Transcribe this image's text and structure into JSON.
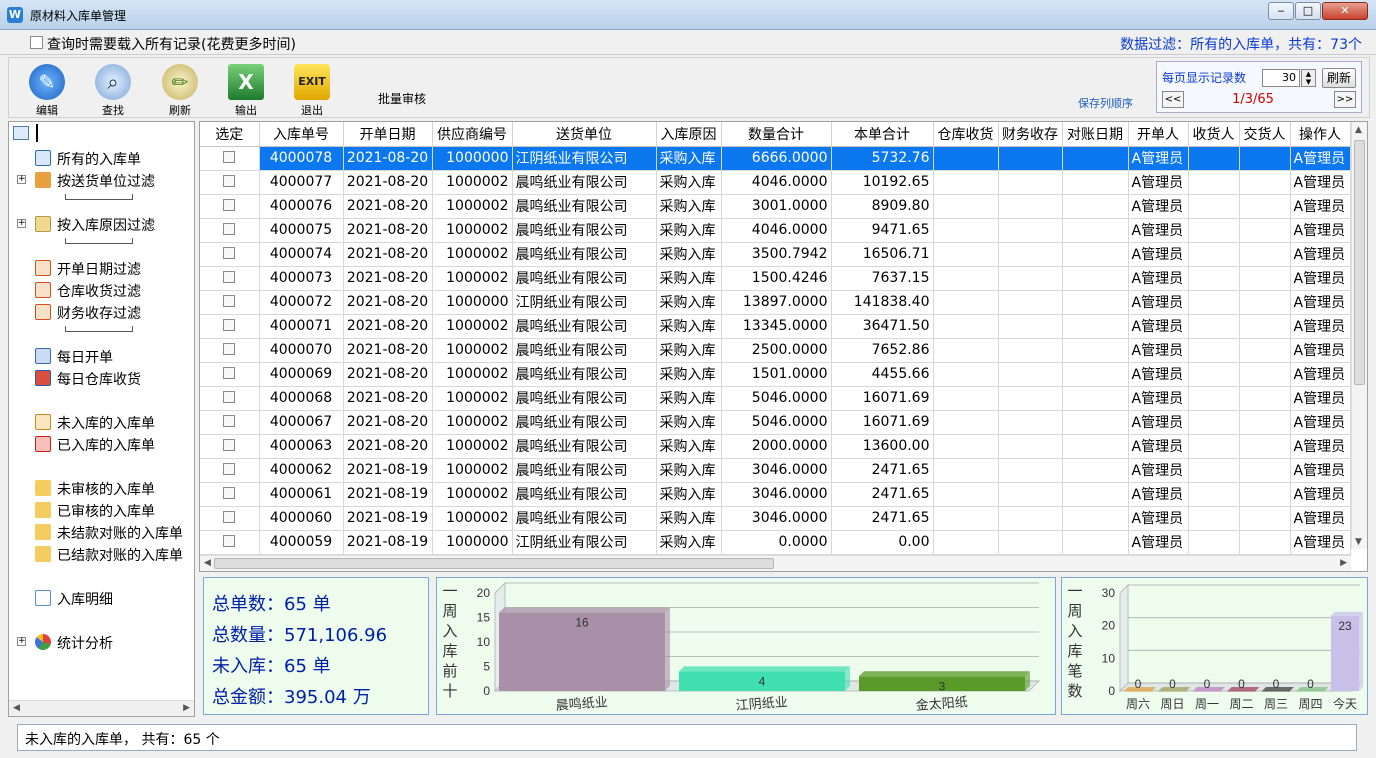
{
  "window": {
    "title": "原材料入库单管理",
    "app_icon": "W"
  },
  "filter_bar": {
    "load_all_label": "查询时需要载入所有记录(花费更多时间)",
    "data_filter_text": "数据过滤：所有的入库单，共有：73个"
  },
  "toolbar": {
    "buttons": [
      {
        "label": "编辑",
        "icon": "edit-pen-icon"
      },
      {
        "label": "查找",
        "icon": "search-magnifier-icon"
      },
      {
        "label": "刷新",
        "icon": "refresh-pencil-icon"
      },
      {
        "label": "输出",
        "icon": "excel-icon"
      },
      {
        "label": "退出",
        "icon": "exit-icon"
      }
    ],
    "batch_audit": "批量审核",
    "save_column_order": "保存列顺序"
  },
  "pager": {
    "per_page_label": "每页显示记录数",
    "per_page_value": "30",
    "refresh_label": "刷新",
    "prev": "<<",
    "page_text": "1/3/65",
    "next": ">>"
  },
  "tree": {
    "items": [
      {
        "label": "所有的入库单",
        "icon": "list-icon"
      },
      {
        "label": "按送货单位过滤",
        "icon": "home-icon"
      },
      {
        "label": "按入库原因过滤",
        "icon": "document-icon"
      },
      {
        "label": "开单日期过滤",
        "icon": "calendar-icon"
      },
      {
        "label": "仓库收货过滤",
        "icon": "calendar-icon"
      },
      {
        "label": "财务收存过滤",
        "icon": "calendar-icon"
      },
      {
        "label": "每日开单",
        "icon": "edit-doc-icon"
      },
      {
        "label": "每日仓库收货",
        "icon": "grid-doc-icon"
      },
      {
        "label": "未入库的入库单",
        "icon": "calendar-add-icon"
      },
      {
        "label": "已入库的入库单",
        "icon": "calendar-check-icon"
      },
      {
        "label": "未审核的入库单",
        "icon": "folder-edit-icon"
      },
      {
        "label": "已审核的入库单",
        "icon": "folder-check-icon"
      },
      {
        "label": "未结款对账的入库单",
        "icon": "folder-edit-icon"
      },
      {
        "label": "已结款对账的入库单",
        "icon": "folder-check-icon"
      },
      {
        "label": "入库明细",
        "icon": "document-edit-icon"
      },
      {
        "label": "统计分析",
        "icon": "pie-chart-icon"
      }
    ]
  },
  "grid": {
    "columns": [
      "选定",
      "入库单号",
      "开单日期",
      "供应商编号",
      "送货单位",
      "入库原因",
      "数量合计",
      "本单合计",
      "仓库收货",
      "财务收存",
      "对账日期",
      "开单人",
      "收货人",
      "交货人",
      "操作人"
    ],
    "rows": [
      [
        "4000078",
        "2021-08-20",
        "1000000",
        "江阴纸业有限公司",
        "采购入库",
        "6666.0000",
        "5732.76",
        "A管理员",
        "A管理员"
      ],
      [
        "4000077",
        "2021-08-20",
        "1000002",
        "晨鸣纸业有限公司",
        "采购入库",
        "4046.0000",
        "10192.65",
        "A管理员",
        "A管理员"
      ],
      [
        "4000076",
        "2021-08-20",
        "1000002",
        "晨鸣纸业有限公司",
        "采购入库",
        "3001.0000",
        "8909.80",
        "A管理员",
        "A管理员"
      ],
      [
        "4000075",
        "2021-08-20",
        "1000002",
        "晨鸣纸业有限公司",
        "采购入库",
        "4046.0000",
        "9471.65",
        "A管理员",
        "A管理员"
      ],
      [
        "4000074",
        "2021-08-20",
        "1000002",
        "晨鸣纸业有限公司",
        "采购入库",
        "3500.7942",
        "16506.71",
        "A管理员",
        "A管理员"
      ],
      [
        "4000073",
        "2021-08-20",
        "1000002",
        "晨鸣纸业有限公司",
        "采购入库",
        "1500.4246",
        "7637.15",
        "A管理员",
        "A管理员"
      ],
      [
        "4000072",
        "2021-08-20",
        "1000000",
        "江阴纸业有限公司",
        "采购入库",
        "13897.0000",
        "141838.40",
        "A管理员",
        "A管理员"
      ],
      [
        "4000071",
        "2021-08-20",
        "1000002",
        "晨鸣纸业有限公司",
        "采购入库",
        "13345.0000",
        "36471.50",
        "A管理员",
        "A管理员"
      ],
      [
        "4000070",
        "2021-08-20",
        "1000002",
        "晨鸣纸业有限公司",
        "采购入库",
        "2500.0000",
        "7652.86",
        "A管理员",
        "A管理员"
      ],
      [
        "4000069",
        "2021-08-20",
        "1000002",
        "晨鸣纸业有限公司",
        "采购入库",
        "1501.0000",
        "4455.66",
        "A管理员",
        "A管理员"
      ],
      [
        "4000068",
        "2021-08-20",
        "1000002",
        "晨鸣纸业有限公司",
        "采购入库",
        "5046.0000",
        "16071.69",
        "A管理员",
        "A管理员"
      ],
      [
        "4000067",
        "2021-08-20",
        "1000002",
        "晨鸣纸业有限公司",
        "采购入库",
        "5046.0000",
        "16071.69",
        "A管理员",
        "A管理员"
      ],
      [
        "4000063",
        "2021-08-20",
        "1000002",
        "晨鸣纸业有限公司",
        "采购入库",
        "2000.0000",
        "13600.00",
        "A管理员",
        "A管理员"
      ],
      [
        "4000062",
        "2021-08-19",
        "1000002",
        "晨鸣纸业有限公司",
        "采购入库",
        "3046.0000",
        "2471.65",
        "A管理员",
        "A管理员"
      ],
      [
        "4000061",
        "2021-08-19",
        "1000002",
        "晨鸣纸业有限公司",
        "采购入库",
        "3046.0000",
        "2471.65",
        "A管理员",
        "A管理员"
      ],
      [
        "4000060",
        "2021-08-19",
        "1000002",
        "晨鸣纸业有限公司",
        "采购入库",
        "3046.0000",
        "2471.65",
        "A管理员",
        "A管理员"
      ],
      [
        "4000059",
        "2021-08-19",
        "1000000",
        "江阴纸业有限公司",
        "采购入库",
        "0.0000",
        "0.00",
        "A管理员",
        "A管理员"
      ]
    ]
  },
  "summary": {
    "total_orders": "总单数：65 单",
    "total_qty": "总数量：571,106.96",
    "not_stocked": "未入库：65 单",
    "total_amount": "总金额：395.04 万"
  },
  "chart_data": [
    {
      "type": "bar",
      "title": "一周入库前十",
      "categories": [
        "晨鸣纸业",
        "江阴纸业",
        "金太阳纸"
      ],
      "values": [
        16,
        4,
        3
      ],
      "ylim": [
        0,
        20
      ],
      "yticks": [
        0,
        5,
        10,
        15,
        20
      ],
      "colors": [
        "#a890a8",
        "#40e0b0",
        "#5a9a28"
      ]
    },
    {
      "type": "bar",
      "title": "一周入库笔数",
      "categories": [
        "周六",
        "周日",
        "周一",
        "周二",
        "周三",
        "周四",
        "今天"
      ],
      "values": [
        0,
        0,
        0,
        0,
        0,
        0,
        23
      ],
      "ylim": [
        0,
        30
      ],
      "yticks": [
        0,
        10,
        20,
        30
      ],
      "colors": [
        "#e0a040",
        "#a0a060",
        "#c080c0",
        "#a04060",
        "#404040",
        "#80c080",
        "#c8c0e8"
      ]
    }
  ],
  "status": {
    "text": "未入库的入库单，  共有：65  个"
  }
}
